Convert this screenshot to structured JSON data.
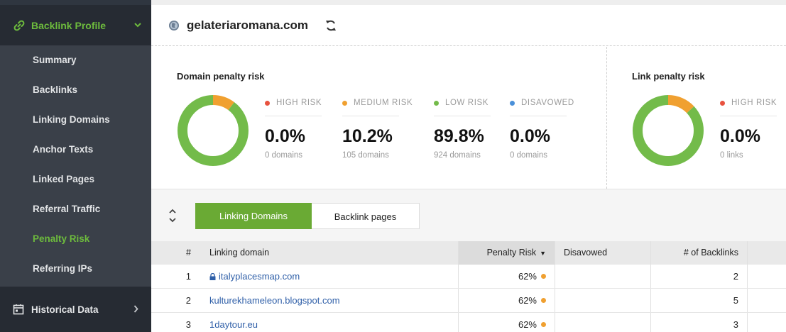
{
  "sidebar": {
    "header_label": "Backlink Profile",
    "header_icon": "link-icon",
    "items": [
      {
        "label": "Summary"
      },
      {
        "label": "Backlinks"
      },
      {
        "label": "Linking Domains"
      },
      {
        "label": "Anchor Texts"
      },
      {
        "label": "Linked Pages"
      },
      {
        "label": "Referral Traffic"
      },
      {
        "label": "Penalty Risk",
        "active": true
      },
      {
        "label": "Referring IPs"
      }
    ],
    "footer_label": "Historical Data",
    "footer_icon": "calendar-icon"
  },
  "header": {
    "domain": "gelateriaromana.com",
    "globe_icon": "globe-icon",
    "refresh_icon": "refresh-icon"
  },
  "domain_penalty": {
    "title": "Domain penalty risk",
    "donut": {
      "high": 0.0,
      "medium": 10.2,
      "low": 89.8
    },
    "stats": [
      {
        "legend": "HIGH RISK",
        "color": "#e8523f",
        "value": "0.0%",
        "sub": "0 domains"
      },
      {
        "legend": "MEDIUM RISK",
        "color": "#f0a030",
        "value": "10.2%",
        "sub": "105 domains"
      },
      {
        "legend": "LOW RISK",
        "color": "#73bb4a",
        "value": "89.8%",
        "sub": "924 domains"
      },
      {
        "legend": "DISAVOWED",
        "color": "#4a90d9",
        "value": "0.0%",
        "sub": "0 domains"
      }
    ]
  },
  "link_penalty": {
    "title": "Link penalty risk",
    "donut": {
      "medium": 13.0,
      "low": 87.0
    },
    "stats": [
      {
        "legend": "HIGH RISK",
        "color": "#e8523f",
        "value": "0.0%",
        "sub": "0 links"
      }
    ]
  },
  "tabs": {
    "sort_icon": "sort-icon",
    "items": [
      {
        "label": "Linking Domains",
        "active": true
      },
      {
        "label": "Backlink pages",
        "active": false
      }
    ]
  },
  "table": {
    "headers": {
      "num": "#",
      "domain": "Linking domain",
      "risk": "Penalty Risk",
      "disavowed": "Disavowed",
      "backlinks": "# of Backlinks"
    },
    "rows": [
      {
        "num": "1",
        "domain": "italyplacesmap.com",
        "secure": true,
        "risk": "62%",
        "disavowed": "",
        "backlinks": "2"
      },
      {
        "num": "2",
        "domain": "kulturekhameleon.blogspot.com",
        "secure": false,
        "risk": "62%",
        "disavowed": "",
        "backlinks": "5"
      },
      {
        "num": "3",
        "domain": "1daytour.eu",
        "secure": false,
        "risk": "62%",
        "disavowed": "",
        "backlinks": "3"
      }
    ],
    "risk_dot_color": "#f0a030"
  },
  "colors": {
    "accent_green": "#6aaa34",
    "sidebar_bg": "#3a4049",
    "link_blue": "#2f5fa8"
  }
}
